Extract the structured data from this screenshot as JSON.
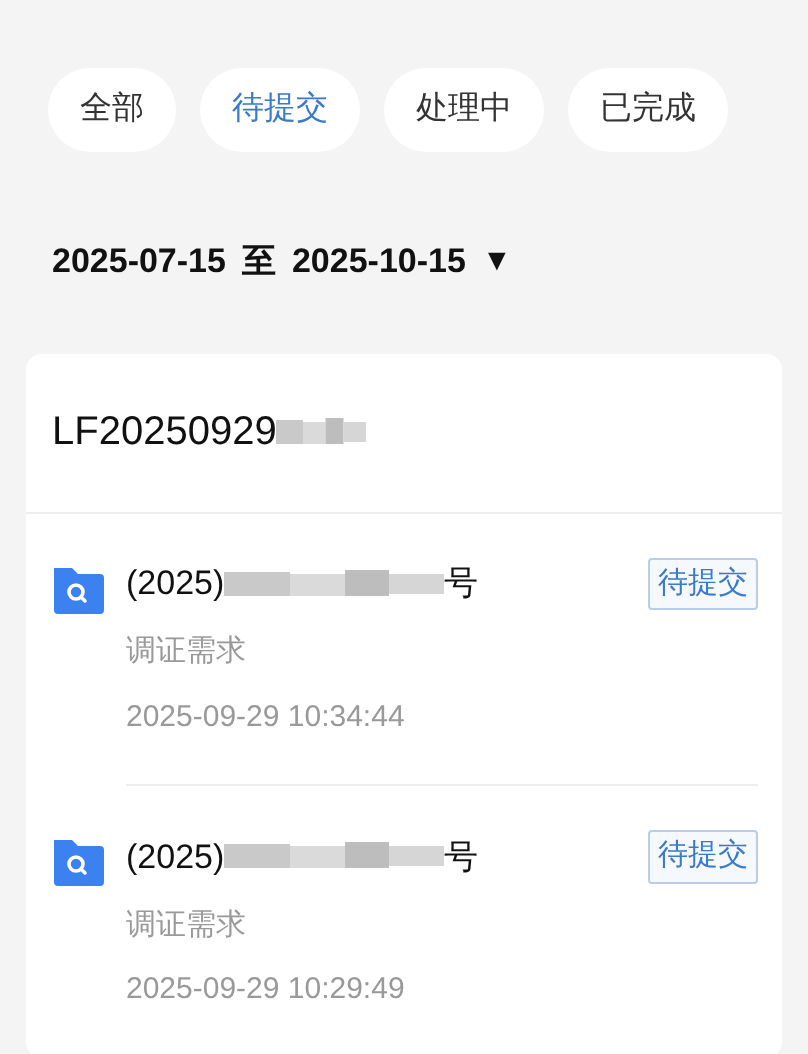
{
  "filter_tabs": [
    {
      "label": "全部",
      "selected": false
    },
    {
      "label": "待提交",
      "selected": true
    },
    {
      "label": "处理中",
      "selected": false
    },
    {
      "label": "已完成",
      "selected": false
    }
  ],
  "date_range": {
    "start": "2025-07-15",
    "separator": "至",
    "end": "2025-10-15",
    "caret": "▼"
  },
  "card": {
    "header": "LF20250929",
    "items": [
      {
        "title_start": "(2025)",
        "title_end": "号",
        "status": "待提交",
        "type": "调证需求",
        "time": "2025-09-29 10:34:44"
      },
      {
        "title_start": "(2025)",
        "title_end": "号",
        "status": "待提交",
        "type": "调证需求",
        "time": "2025-09-29 10:29:49"
      }
    ]
  }
}
